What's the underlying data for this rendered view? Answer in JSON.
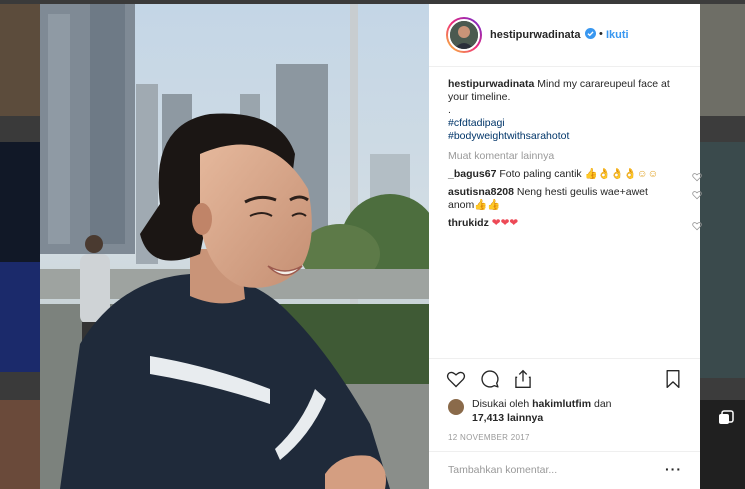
{
  "post": {
    "username": "hestipurwadinata",
    "follow_label": "Ikuti",
    "separator": "•",
    "verified_icon": "verified-badge-icon"
  },
  "caption": {
    "username": "hestipurwadinata",
    "text": " Mind my carareupeul face at your timeline.",
    "dot": ".",
    "hashtags": [
      "#cfdtadipagi",
      "#bodyweightwithsarahotot"
    ]
  },
  "load_more_label": "Muat komentar lainnya",
  "comments": [
    {
      "username": "_bagus67",
      "text": " Foto paling cantik ",
      "emoji": "👍👌👌👌☺☺"
    },
    {
      "username": "asutisna8208",
      "text": " Neng hesti geulis wae+awet anom",
      "emoji": "👍👍"
    },
    {
      "username": "thrukidz",
      "text": " ",
      "emoji": "❤❤❤"
    }
  ],
  "likes": {
    "prefix": "Disukai oleh ",
    "user": "hakimlutfim",
    "middle": " dan ",
    "count": "17,413 lainnya"
  },
  "date": "12 NOVEMBER 2017",
  "add_comment_placeholder": "Tambahkan komentar...",
  "more_label": "···",
  "icons": {
    "like": "heart-icon",
    "comment": "comment-icon",
    "share": "share-icon",
    "save": "bookmark-icon"
  },
  "colors": {
    "link_blue": "#3897f0",
    "hashtag": "#003569",
    "muted": "#999999",
    "heart_red": "#ed4956"
  }
}
